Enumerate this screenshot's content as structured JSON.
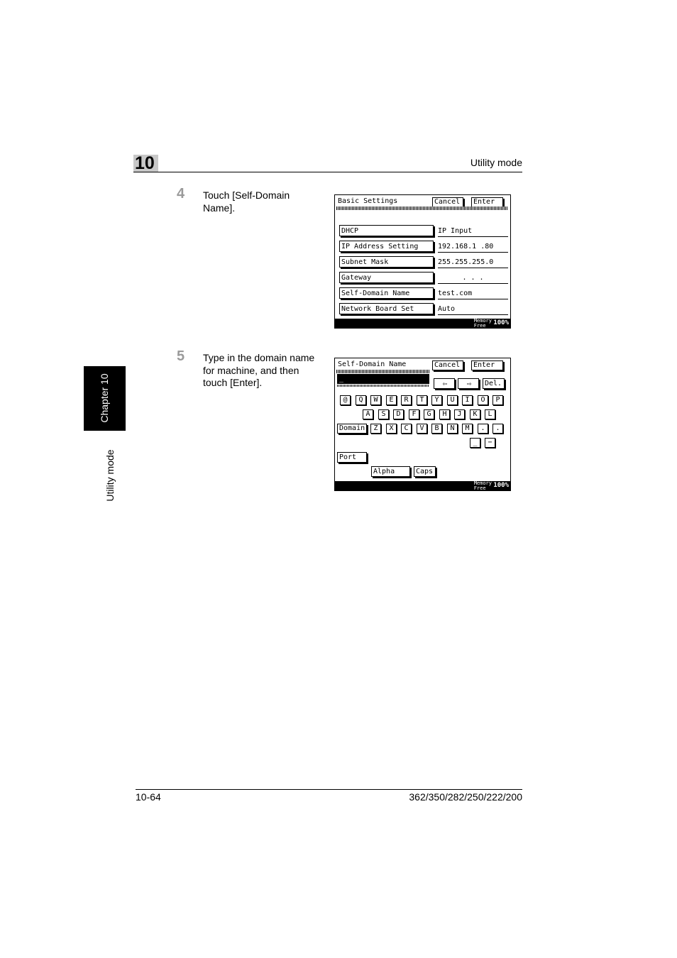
{
  "header": {
    "chapter_number": "10",
    "section_title": "Utility mode"
  },
  "side_tab": {
    "chapter_label": "Chapter 10",
    "mode_label": "Utility mode"
  },
  "steps": [
    {
      "number": "4",
      "text": "Touch [Self-Domain Name]."
    },
    {
      "number": "5",
      "text": "Type in the domain name for machine, and then touch [Enter]."
    }
  ],
  "screen1": {
    "title": "Basic Settings",
    "cancel_label": "Cancel",
    "enter_label": "Enter",
    "rows": [
      {
        "label": "DHCP",
        "value": "IP Input"
      },
      {
        "label": "IP Address Setting",
        "value": "192.168.1  .80"
      },
      {
        "label": "Subnet Mask",
        "value": "255.255.255.0"
      },
      {
        "label": "Gateway",
        "value": ".   .   ."
      },
      {
        "label": "Self-Domain Name",
        "value": "test.com"
      },
      {
        "label": "Network Board Set",
        "value": "Auto"
      }
    ],
    "memory_label_1": "Memory",
    "memory_label_2": "Free",
    "memory_value": "100%"
  },
  "screen2": {
    "title": "Self-Domain Name",
    "cancel_label": "Cancel",
    "enter_label": "Enter",
    "input_value": "_",
    "left_arrow": "⇦",
    "right_arrow": "⇨",
    "del_label": "Del.",
    "row1": [
      "@",
      "Q",
      "W",
      "E",
      "R",
      "T",
      "Y",
      "U",
      "I",
      "O",
      "P"
    ],
    "row2": [
      "A",
      "S",
      "D",
      "F",
      "G",
      "H",
      "J",
      "K",
      "L"
    ],
    "domain_label": "Domain",
    "row3": [
      "Z",
      "X",
      "C",
      "V",
      "B",
      "N",
      "M",
      ".",
      "."
    ],
    "row4": [
      "_",
      "−"
    ],
    "port_label": "Port",
    "alpha_label": "Alpha",
    "caps_label": "Caps",
    "memory_label_1": "Memory",
    "memory_label_2": "Free",
    "memory_value": "100%"
  },
  "footer": {
    "page_number": "10-64",
    "model_numbers": "362/350/282/250/222/200"
  }
}
